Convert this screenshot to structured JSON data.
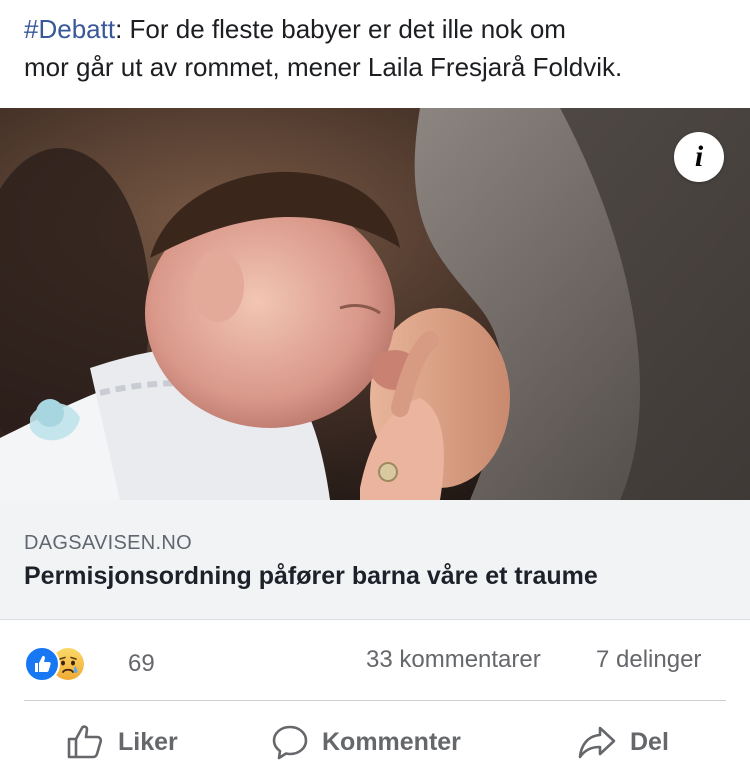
{
  "post": {
    "hashtag": "#Debatt",
    "text_line1_rest": ": For de fleste babyer er det ille nok om",
    "text_line2": "mor går ut av rommet, mener Laila Fresjarå Foldvik."
  },
  "link_card": {
    "domain": "DAGSAVISEN.NO",
    "title": "Permisjonsordning påfører barna våre et traume"
  },
  "stats": {
    "reaction_count": "69",
    "comments": "33 kommentarer",
    "shares": "7 delinger"
  },
  "actions": {
    "like": "Liker",
    "comment": "Kommenter",
    "share": "Del"
  },
  "icons": {
    "info": "i",
    "reactions": [
      "like-icon",
      "sad-icon"
    ],
    "action_icons": [
      "thumbs-up-icon",
      "comment-bubble-icon",
      "share-arrow-icon"
    ]
  },
  "colors": {
    "hashtag": "#385898",
    "like_blue": "#1877f2",
    "secondary_text": "#65676b",
    "card_bg": "#f2f3f5"
  }
}
